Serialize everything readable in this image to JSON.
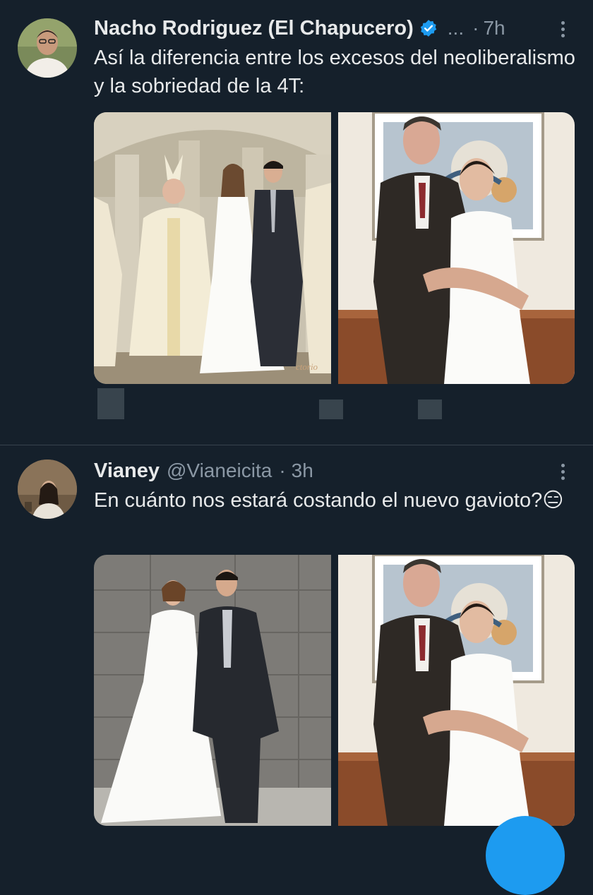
{
  "tweets": [
    {
      "name": "Nacho Rodriguez (El Chapucero)",
      "handle_truncated": "...",
      "separator": "·",
      "time": "7h",
      "text": "Así la diferencia entre los excesos del neoliberalismo y la sobriedad de la 4T:",
      "photo_watermark": "ctorio"
    },
    {
      "name": "Vianey",
      "handle": "@Vianeicita",
      "separator": "·",
      "time": "3h",
      "text": "En cuánto nos estará costando el nuevo gavioto?😑"
    }
  ],
  "colors": {
    "background": "#15202b",
    "text_primary": "#e7e9ea",
    "text_secondary": "#8b98a5",
    "accent": "#1d9bf0",
    "divider": "#38444d"
  },
  "icons": [
    "verified-badge-icon",
    "more-options-icon",
    "compose-icon"
  ]
}
